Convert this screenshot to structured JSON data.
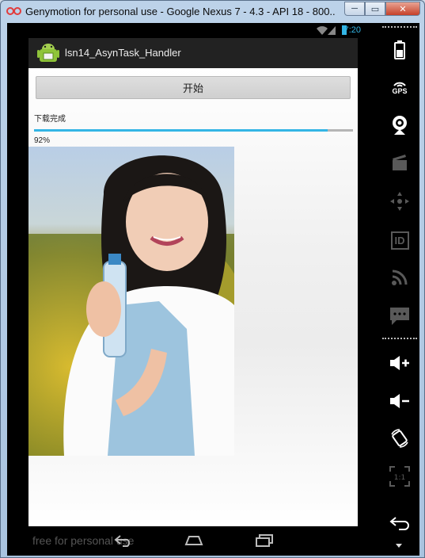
{
  "window": {
    "title": "Genymotion for personal use - Google Nexus 7 - 4.3 - API 18 - 800...",
    "minimize_label": "─",
    "maximize_label": "▭",
    "close_label": "✕"
  },
  "statusbar": {
    "time": "7:20",
    "accent_color": "#33b5e5"
  },
  "app": {
    "title": "lsn14_AsynTask_Handler",
    "start_button_label": "开始",
    "status_text": "下载完成",
    "progress": 0.92,
    "percent_text": "92%"
  },
  "navbar": {
    "watermark": "free for personal use"
  },
  "sidebar": {
    "items": [
      {
        "name": "battery-icon"
      },
      {
        "name": "gps-icon",
        "label": "GPS"
      },
      {
        "name": "camera-icon"
      },
      {
        "name": "video-capture-icon"
      },
      {
        "name": "dpad-icon"
      },
      {
        "name": "device-id-icon",
        "label": "ID"
      },
      {
        "name": "rss-icon"
      },
      {
        "name": "sms-icon"
      },
      {
        "name": "volume-up-icon"
      },
      {
        "name": "volume-down-icon"
      },
      {
        "name": "rotate-icon"
      },
      {
        "name": "pixel-perfect-icon",
        "label": "1:1"
      },
      {
        "name": "back-icon"
      }
    ]
  }
}
